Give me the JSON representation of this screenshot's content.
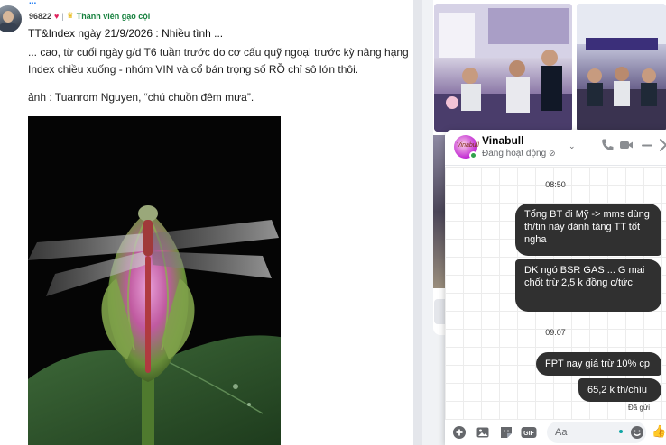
{
  "post": {
    "author_partial": "...",
    "points": "96822",
    "rank": "Thành viên gạo cội",
    "title": "TT&Index ngày 21/9/2026 : Nhiều tình ...",
    "lines": [
      "... cao, từ cuối ngày g/d T6 tuần trước do cơ cấu quỹ ngoại trước kỳ nâng hạng",
      "Index chiều xuống - nhóm VIN và cổ bán trọng số RỒ chỉ sô lớn thôi.",
      "ảnh : Tuanrom Nguyen, “chú chuồn đêm mưa”."
    ]
  },
  "chat": {
    "name": "Vinabull",
    "avatar_text": "Vinabull",
    "status": "Đang hoạt động",
    "messages": [
      {
        "time": "08:50"
      },
      {
        "text": "Tổng BT đi Mỹ -> mms dùng th/tin này đánh tăng TT tốt ngha"
      },
      {
        "text": "DK ngó BSR GAS ... G mai chốt trừ 2,5 k đồng c/tức"
      },
      {
        "time": "09:07"
      },
      {
        "text": "FPT nay giá trừ 10% cp"
      },
      {
        "text": "65,2 k th/chíu"
      }
    ],
    "sent_label": "Đã gửi",
    "input_placeholder": "Aa",
    "gif_label": "GIF"
  },
  "colors": {
    "bubble": "#303030",
    "online": "#31a24c",
    "accent": "#c026d3",
    "rank": "#15803d"
  },
  "icons": [
    "heart-icon",
    "rank-icon",
    "mute-icon",
    "chevron-down-icon",
    "phone-icon",
    "video-icon",
    "minimize-icon",
    "close-icon",
    "plus-icon",
    "photo-icon",
    "sticker-icon",
    "gif-icon",
    "emoji-icon",
    "like-icon"
  ]
}
